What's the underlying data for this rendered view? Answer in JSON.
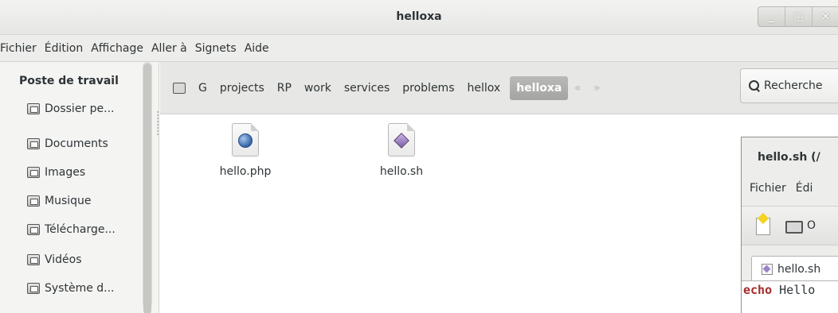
{
  "window": {
    "title": "helloxa",
    "controls": {
      "minimize": "_",
      "maximize": "□",
      "close": "✕"
    }
  },
  "menubar": [
    "Fichier",
    "Édition",
    "Affichage",
    "Aller à",
    "Signets",
    "Aide"
  ],
  "sidebar": {
    "heading": "Poste de travail",
    "items": [
      {
        "label": "Dossier pe...",
        "icon": "home-folder-icon"
      },
      {
        "label": "Documents",
        "icon": "documents-folder-icon"
      },
      {
        "label": "Images",
        "icon": "pictures-folder-icon"
      },
      {
        "label": "Musique",
        "icon": "music-folder-icon"
      },
      {
        "label": "Télécharge...",
        "icon": "downloads-folder-icon"
      },
      {
        "label": "Vidéos",
        "icon": "videos-folder-icon"
      },
      {
        "label": "Système d...",
        "icon": "drive-icon"
      }
    ]
  },
  "pathbar": {
    "crumbs": [
      "G",
      "projects",
      "RP",
      "work",
      "services",
      "problems",
      "hellox"
    ],
    "active": "helloxa",
    "search_label": "Recherche"
  },
  "files": [
    {
      "name": "hello.php",
      "icon": "php-file-icon"
    },
    {
      "name": "hello.sh",
      "icon": "shell-script-icon"
    }
  ],
  "editor_window": {
    "title": "hello.sh (/",
    "menu": [
      "Fichier",
      "Édi"
    ],
    "toolbar_open_label": "O",
    "tab_label": "hello.sh",
    "code_keyword": "echo",
    "code_rest": " Hello"
  }
}
